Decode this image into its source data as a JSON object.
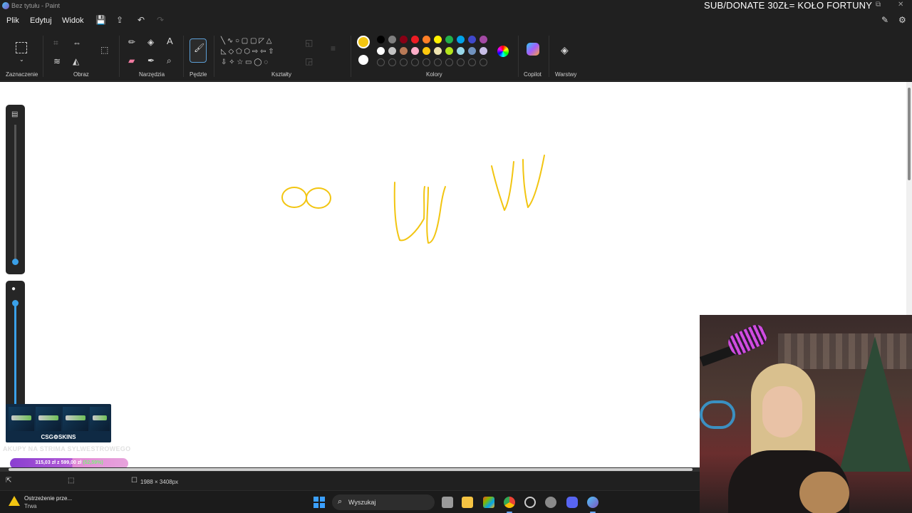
{
  "window": {
    "title": "Bez tytułu - Paint"
  },
  "overlay": {
    "banner": "SUB/DONATE 30ZŁ= KOŁO FORTUNY"
  },
  "menu": {
    "items": [
      "Plik",
      "Edytuj",
      "Widok"
    ]
  },
  "ribbon": {
    "groups": {
      "selection": "Zaznaczenie",
      "image": "Obraz",
      "tools": "Narzędzia",
      "brushes": "Pędzle",
      "shapes": "Kształty",
      "colors": "Kolory",
      "copilot": "Copilot",
      "layers": "Warstwy"
    },
    "current_color": "#f2c511",
    "secondary_color": "#ffffff",
    "palette": [
      [
        "#000000",
        "#7f7f7f",
        "#880015",
        "#ed1c24",
        "#ff7f27",
        "#fff200",
        "#22b14c",
        "#00a2e8",
        "#3f48cc",
        "#a349a4"
      ],
      [
        "#ffffff",
        "#c3c3c3",
        "#b97a57",
        "#ffaec9",
        "#ffc90e",
        "#efe4b0",
        "#b5e61d",
        "#99d9ea",
        "#7092be",
        "#c8bfe7"
      ]
    ]
  },
  "canvas": {
    "stroke_color": "#f2c511",
    "background": "#ffffff"
  },
  "status": {
    "dimensions": "1988 × 3408px"
  },
  "stream": {
    "skins_brand": "CSG⚙SKINS",
    "promo": "AKUPY NA STRIMA SYLWESTROWEGO",
    "donation_text": "315,03 zł z 599,00 zł",
    "donation_pct": "(52,59%)",
    "donation_progress": 0.5259
  },
  "taskbar": {
    "notification_title": "Ostrzeżenie prze...",
    "notification_sub": "Trwa",
    "search_placeholder": "Wyszukaj"
  }
}
